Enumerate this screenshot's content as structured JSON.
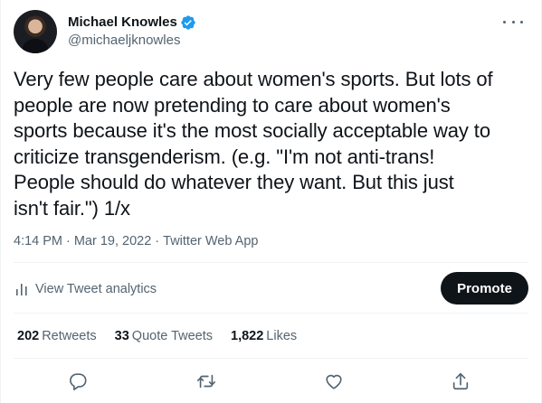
{
  "author": {
    "display_name": "Michael Knowles",
    "handle": "@michaeljknowles",
    "verified": true,
    "verified_color": "#1d9bf0"
  },
  "tweet": {
    "text": "Very few people care about women's sports. But lots of\npeople are now pretending to care about women's\nsports because it's the most socially acceptable way to\ncriticize transgenderism. (e.g. \"I'm not anti-trans!\nPeople should do whatever they want. But this just\nisn't fair.\") 1/x",
    "time": "4:14 PM",
    "date": "Mar 19, 2022",
    "source": "Twitter Web App",
    "separator": "·"
  },
  "analytics": {
    "label": "View Tweet analytics",
    "icon": "bar-chart-icon"
  },
  "promote": {
    "label": "Promote"
  },
  "stats": {
    "retweets_count": "202",
    "retweets_label": "Retweets",
    "quotes_count": "33",
    "quotes_label": "Quote Tweets",
    "likes_count": "1,822",
    "likes_label": "Likes"
  },
  "actions": [
    {
      "name": "reply",
      "icon": "reply-icon"
    },
    {
      "name": "retweet",
      "icon": "retweet-icon"
    },
    {
      "name": "like",
      "icon": "heart-icon"
    },
    {
      "name": "share",
      "icon": "share-icon"
    }
  ],
  "colors": {
    "text": "#0f1419",
    "secondary": "#536471",
    "divider": "#eff3f4",
    "promote_bg": "#0f1419"
  }
}
